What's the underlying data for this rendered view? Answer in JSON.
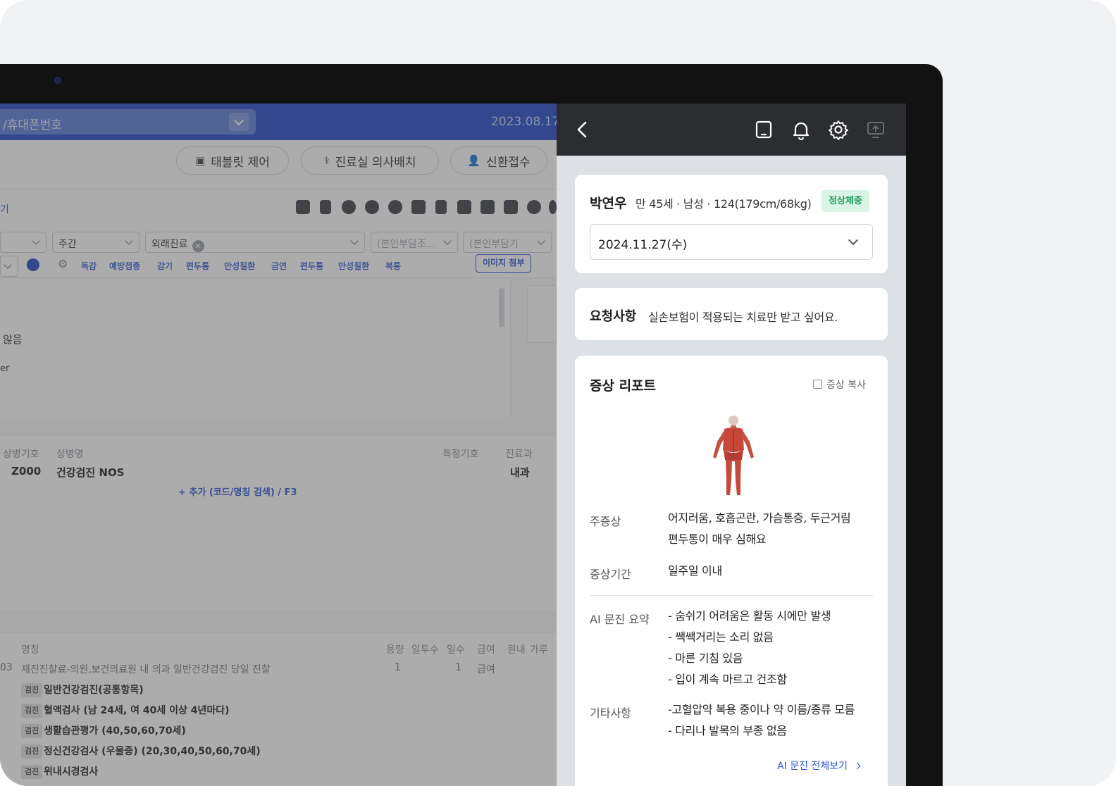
{
  "emr": {
    "search_placeholder": "/휴대폰번호",
    "date": "2023.08.17.",
    "toolbar": {
      "tablet_control": "태블릿 제어",
      "room_assign": "진료실 의사배치",
      "new_patient": "신환접수"
    },
    "left_link": "기",
    "filters": {
      "period": "주간",
      "visit_type": "외래진료",
      "copay_rate_placeholder": "(본인부담조...",
      "copay_placeholder": "(본인부담기"
    },
    "tags": [
      "독감",
      "예방접종",
      "감기",
      "편두통",
      "만성질환",
      "금연",
      "편두통",
      "만성질환",
      "복통"
    ],
    "attach_image": "이미지 첨부",
    "note_line1": "않음",
    "note_line2": "er",
    "diagnosis": {
      "headers": {
        "code": "상병기호",
        "name": "상병명",
        "special": "특정기호",
        "dept": "진료과"
      },
      "row": {
        "code": "Z000",
        "name": "건강검진 NOS",
        "dept": "내과"
      },
      "add": "+ 추가 (코드/명칭 검색) / F3"
    },
    "orders": {
      "headers": {
        "name": "명칭",
        "dose": "용량",
        "daily": "일투수",
        "days": "일수",
        "pay": "급여",
        "out": "원내",
        "powder": "가루"
      },
      "first": {
        "code": "03",
        "name": "재진진찰료-의원,보건의료원 내 의과 일반건강검진 당일 진찰",
        "dose": "1",
        "days": "1",
        "pay": "급여"
      },
      "badge": "검진",
      "items": [
        "일반건강검진(공통항목)",
        "혈액검사 (남 24세, 여 40세 이상 4년마다)",
        "생활습관평가 (40,50,60,70세)",
        "정신건강검사 (우울증) (20,30,40,50,60,70세)",
        "위내시경검사"
      ]
    }
  },
  "panel": {
    "header_icons": [
      "back-icon",
      "tablet-icon",
      "bell-icon",
      "gear-icon",
      "screen-share-icon"
    ],
    "patient": {
      "name": "박연우",
      "meta": "만 45세 · 남성 · 124(179cm/68kg)",
      "badge": "정상체중",
      "date": "2024.11.27(수)"
    },
    "request": {
      "label": "요청사항",
      "text": "실손보험이 적용되는 치료만 받고 싶어요."
    },
    "report": {
      "title": "증상 리포트",
      "copy": "증상 복사",
      "main_label": "주증상",
      "main_lines": [
        "어지러움, 호흡곤란, 가슴통증, 두근거림",
        "편두통이 매우 심해요"
      ],
      "period_label": "증상기간",
      "period_value": "일주일 이내",
      "ai_label": "AI 문진 요약",
      "ai_lines": [
        "- 숨쉬기 어려움은 활동 시에만 발생",
        "- 쌕쌕거리는 소리 없음",
        "- 마른 기침 있음",
        "- 입이 계속 마르고 건조함"
      ],
      "etc_label": "기타사항",
      "etc_lines": [
        "-고혈압약 복용 중이나 약 이름/종류 모름",
        "- 다리나 발목의 부종 없음"
      ],
      "ai_link": "AI 문진 전체보기"
    },
    "colors": {
      "header": "#2c2d31",
      "badge_bg": "#daf5e6",
      "badge_text": "#1f9d5a",
      "link": "#2a57d6",
      "emr_primary": "#2148c7"
    }
  }
}
